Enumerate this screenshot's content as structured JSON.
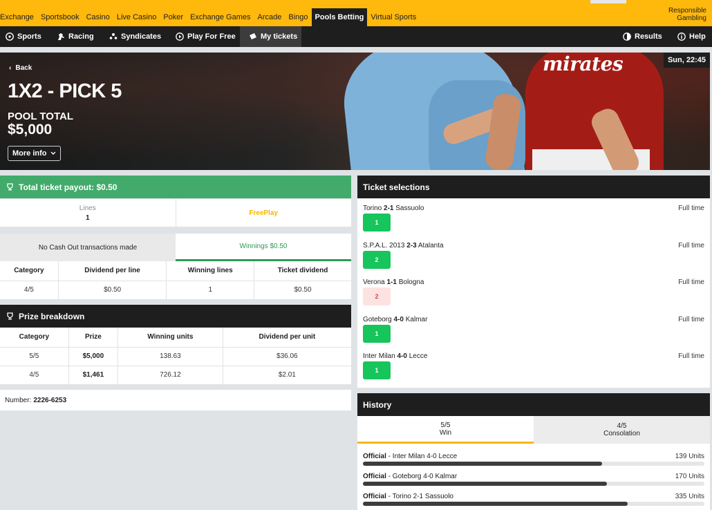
{
  "top_nav": {
    "items": [
      "Exchange",
      "Sportsbook",
      "Casino",
      "Live Casino",
      "Poker",
      "Exchange Games",
      "Arcade",
      "Bingo",
      "Pools Betting",
      "Virtual Sports"
    ],
    "active_index": 8,
    "responsible_line1": "Responsible",
    "responsible_line2": "Gambling"
  },
  "sub_nav": {
    "sports": "Sports",
    "racing": "Racing",
    "syndicates": "Syndicates",
    "play_free": "Play For Free",
    "my_tickets": "My tickets",
    "results": "Results",
    "help": "Help"
  },
  "hero": {
    "back": "Back",
    "title": "1X2 - PICK 5",
    "pool_label": "POOL TOTAL",
    "pool_value": "$5,000",
    "more_info": "More info",
    "clock": "Sun, 22:45",
    "sponsor": "Emirates"
  },
  "payout": {
    "title": "Total ticket payout: $0.50",
    "lines_label": "Lines",
    "lines_value": "1",
    "freeplay": "FreePlay"
  },
  "cashout_tabs": {
    "left": "No Cash Out transactions made",
    "right": "Winnings $0.50"
  },
  "dividend_table": {
    "headers": [
      "Category",
      "Dividend per line",
      "Winning lines",
      "Ticket dividend"
    ],
    "rows": [
      [
        "4/5",
        "$0.50",
        "1",
        "$0.50"
      ]
    ]
  },
  "prize": {
    "title": "Prize breakdown",
    "headers": [
      "Category",
      "Prize",
      "Winning units",
      "Dividend per unit"
    ],
    "rows": [
      [
        "5/5",
        "$5,000",
        "138.63",
        "$36.06"
      ],
      [
        "4/5",
        "$1,461",
        "726.12",
        "$2.01"
      ]
    ]
  },
  "ticket_number": {
    "label": "Number:",
    "value": "2226-6253"
  },
  "selections": {
    "title": "Ticket selections",
    "items": [
      {
        "home": "Torino",
        "score": "2-1",
        "away": "Sassuolo",
        "status": "Full time",
        "pick": "1",
        "correct": true
      },
      {
        "home": "S.P.A.L. 2013",
        "score": "2-3",
        "away": "Atalanta",
        "status": "Full time",
        "pick": "2",
        "correct": true
      },
      {
        "home": "Verona",
        "score": "1-1",
        "away": "Bologna",
        "status": "Full time",
        "pick": "2",
        "correct": false
      },
      {
        "home": "Goteborg",
        "score": "4-0",
        "away": "Kalmar",
        "status": "Full time",
        "pick": "1",
        "correct": true
      },
      {
        "home": "Inter Milan",
        "score": "4-0",
        "away": "Lecce",
        "status": "Full time",
        "pick": "1",
        "correct": true
      }
    ]
  },
  "history": {
    "title": "History",
    "tabs": [
      {
        "top": "5/5",
        "bottom": "Win"
      },
      {
        "top": "4/5",
        "bottom": "Consolation"
      }
    ],
    "rows": [
      {
        "tag": "Official",
        "text": " - Inter Milan 4-0 Lecce",
        "units": "139 Units",
        "fraction": 0.7
      },
      {
        "tag": "Official",
        "text": " - Goteborg 4-0 Kalmar",
        "units": "170 Units",
        "fraction": 0.715
      },
      {
        "tag": "Official",
        "text": " - Torino 2-1 Sassuolo",
        "units": "335 Units",
        "fraction": 0.775
      }
    ]
  },
  "colors": {
    "brand_yellow": "#ffb80c",
    "dark": "#1e1e1e",
    "green": "#42ab6b",
    "win_green": "#16c55b"
  }
}
